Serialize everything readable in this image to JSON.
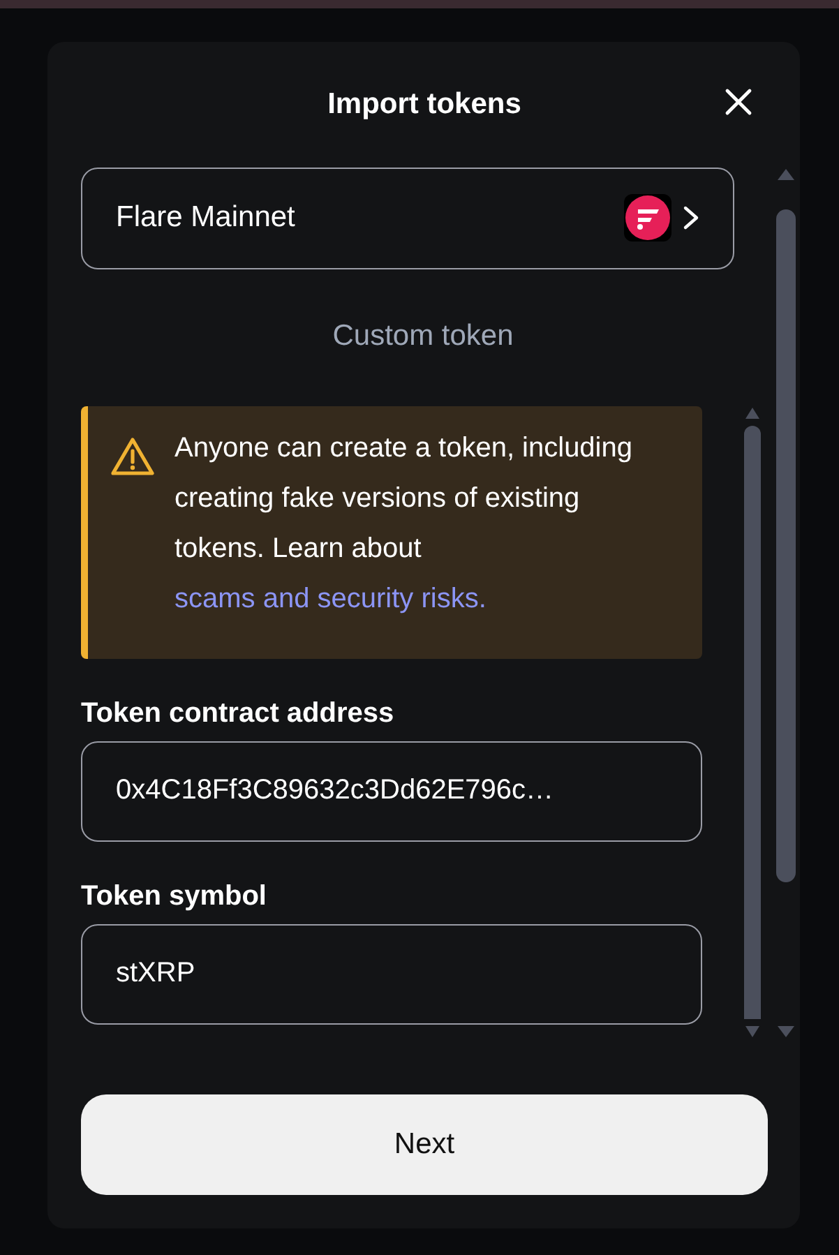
{
  "dialog": {
    "title": "Import tokens"
  },
  "network": {
    "label": "Flare Mainnet"
  },
  "section": {
    "label": "Custom token"
  },
  "warning": {
    "text": "Anyone can create a token, including creating fake versions of existing tokens. Learn about ",
    "link": "scams and security risks."
  },
  "fields": [
    {
      "label": "Token contract address",
      "value": "0x4C18Ff3C89632c3Dd62E796c…"
    },
    {
      "label": "Token symbol",
      "value": "stXRP"
    }
  ],
  "buttons": [
    {
      "label": "Next"
    }
  ]
}
